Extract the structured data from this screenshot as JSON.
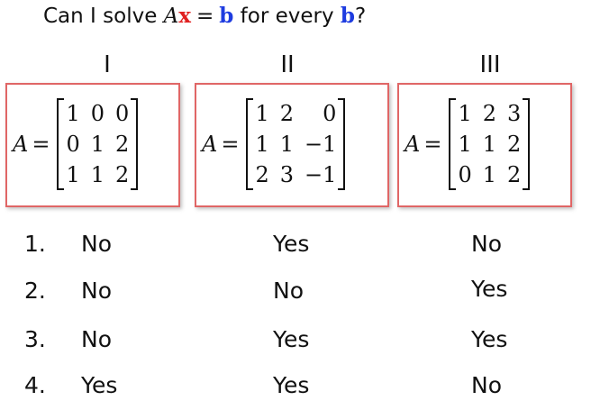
{
  "question": {
    "prefix": "Can I solve ",
    "A": "A",
    "x": "x",
    "equals": "=",
    "b": "b",
    "middle": " for every ",
    "b2": "b",
    "suffix": "?"
  },
  "columns": [
    {
      "roman": "I",
      "lhs": "A",
      "eq": "=",
      "matrix": [
        [
          "1",
          "0",
          "0"
        ],
        [
          "0",
          "1",
          "2"
        ],
        [
          "1",
          "1",
          "2"
        ]
      ]
    },
    {
      "roman": "II",
      "lhs": "A",
      "eq": "=",
      "matrix": [
        [
          "1",
          "2",
          "0"
        ],
        [
          "1",
          "1",
          "−1"
        ],
        [
          "2",
          "3",
          "−1"
        ]
      ]
    },
    {
      "roman": "III",
      "lhs": "A",
      "eq": "=",
      "matrix": [
        [
          "1",
          "2",
          "3"
        ],
        [
          "1",
          "1",
          "2"
        ],
        [
          "0",
          "1",
          "2"
        ]
      ]
    }
  ],
  "options": [
    {
      "num": "1.",
      "answers": [
        "No",
        "Yes",
        "No"
      ]
    },
    {
      "num": "2.",
      "answers": [
        "No",
        "No",
        "Yes"
      ]
    },
    {
      "num": "3.",
      "answers": [
        "No",
        "Yes",
        "Yes"
      ]
    },
    {
      "num": "4.",
      "answers": [
        "Yes",
        "Yes",
        "No"
      ]
    }
  ],
  "colors": {
    "x": "#e02020",
    "b": "#1e3ce0",
    "box_border": "#e06666"
  }
}
